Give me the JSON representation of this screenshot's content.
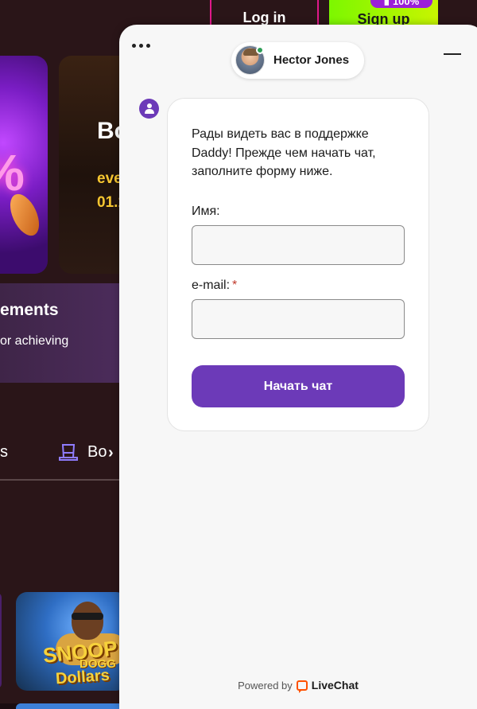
{
  "site": {
    "login_label": "Log in",
    "signup_label": "Sign up",
    "signup_badge": "100%",
    "promo1_text": "%",
    "promo2_title": "Bo",
    "promo2_line1": "eve",
    "promo2_line2": "01.1",
    "achievements_title": "ements",
    "achievements_sub": "or achieving",
    "nav_left": "s",
    "nav_bonus": "Bo",
    "game_title_line1": "SNOOP",
    "game_title_line2": "DOGG",
    "game_title_line3": "Dollars",
    "colors": {
      "login_border": "#e0198a",
      "signup_bg": "#7cf700",
      "badge_bg": "#9b1fd8",
      "promo_gold": "#f6c630"
    }
  },
  "chat": {
    "agent_name": "Hector Jones",
    "agent_status": "online",
    "intro_message": "Рады видеть вас в поддержке Daddy! Прежде чем начать чат, заполните форму ниже.",
    "form": {
      "name_label": "Имя:",
      "name_value": "",
      "email_label": "e-mail:",
      "email_required_mark": "*",
      "email_value": "",
      "submit_label": "Начать чат"
    },
    "footer_powered": "Powered by",
    "footer_brand": "LiveChat",
    "colors": {
      "accent": "#6c3ab8",
      "online": "#2e9e57",
      "brand": "#ff5100",
      "required": "#c0392b"
    }
  }
}
